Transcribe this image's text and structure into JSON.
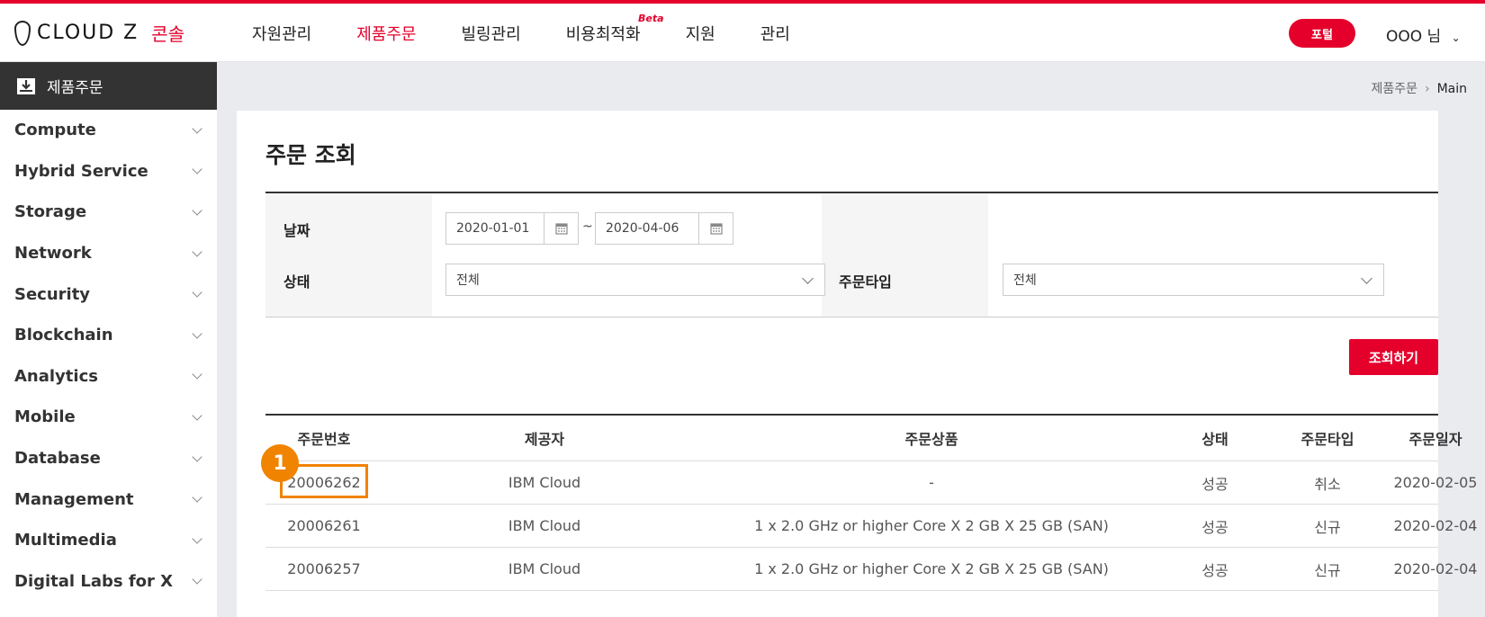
{
  "header": {
    "logo_text": "CLOUD Z",
    "logo_sub": "콘솔",
    "nav": [
      {
        "label": "자원관리"
      },
      {
        "label": "제품주문"
      },
      {
        "label": "빌링관리"
      },
      {
        "label": "비용최적화",
        "badge": "Beta"
      },
      {
        "label": "지원"
      },
      {
        "label": "관리"
      }
    ],
    "portal_label": "포털",
    "user_label": "OOO 님"
  },
  "sidebar": {
    "title": "제품주문",
    "items": [
      {
        "label": "Compute"
      },
      {
        "label": "Hybrid Service"
      },
      {
        "label": "Storage"
      },
      {
        "label": "Network"
      },
      {
        "label": "Security"
      },
      {
        "label": "Blockchain"
      },
      {
        "label": "Analytics"
      },
      {
        "label": "Mobile"
      },
      {
        "label": "Database"
      },
      {
        "label": "Management"
      },
      {
        "label": "Multimedia"
      },
      {
        "label": "Digital Labs for X"
      }
    ]
  },
  "breadcrumb": {
    "parent": "제품주문",
    "current": "Main"
  },
  "page": {
    "title": "주문 조회"
  },
  "filter": {
    "date_label": "날짜",
    "date_from": "2020-01-01",
    "date_to": "2020-04-06",
    "date_sep": "~",
    "status_label": "상태",
    "status_value": "전체",
    "order_type_label": "주문타입",
    "order_type_value": "전체",
    "search_button": "조회하기"
  },
  "table": {
    "columns": [
      "주문번호",
      "제공자",
      "주문상품",
      "상태",
      "주문타입",
      "주문일자"
    ],
    "rows": [
      [
        "20006262",
        "IBM Cloud",
        "-",
        "성공",
        "취소",
        "2020-02-05"
      ],
      [
        "20006261",
        "IBM Cloud",
        "1 x 2.0 GHz or higher Core X 2 GB X 25 GB (SAN)",
        "성공",
        "신규",
        "2020-02-04"
      ],
      [
        "20006257",
        "IBM Cloud",
        "1 x 2.0 GHz or higher Core X 2 GB X 25 GB (SAN)",
        "성공",
        "신규",
        "2020-02-04"
      ]
    ]
  },
  "annotation": {
    "marker": "1"
  },
  "colors": {
    "accent": "#e4002b",
    "annotation": "#f08300",
    "sidebar_head": "#333333"
  }
}
